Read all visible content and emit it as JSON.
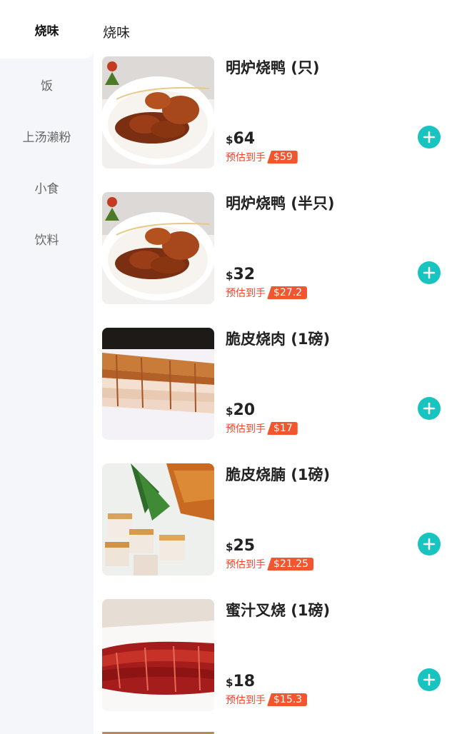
{
  "sidebar": {
    "items": [
      {
        "label": "烧味",
        "active": true
      },
      {
        "label": "饭"
      },
      {
        "label": "上汤濑粉"
      },
      {
        "label": "小食"
      },
      {
        "label": "饮料"
      }
    ]
  },
  "main": {
    "section_title": "烧味",
    "est_label": "预估到手",
    "add_icon": "plus-circle-icon",
    "accent_color": "#18c4c0",
    "badge_color": "#f2562f",
    "items": [
      {
        "name": "明炉烧鸭 (只)",
        "currency": "$",
        "price": "64",
        "est_price": "$59",
        "image": "roast-duck-image"
      },
      {
        "name": "明炉烧鸭 (半只)",
        "currency": "$",
        "price": "32",
        "est_price": "$27.2",
        "image": "roast-duck-image"
      },
      {
        "name": "脆皮烧肉 (1磅)",
        "currency": "$",
        "price": "20",
        "est_price": "$17",
        "image": "roast-pork-image"
      },
      {
        "name": "脆皮烧腩 (1磅)",
        "currency": "$",
        "price": "25",
        "est_price": "$21.25",
        "image": "roast-pork-belly-image"
      },
      {
        "name": "蜜汁叉烧 (1磅)",
        "currency": "$",
        "price": "18",
        "est_price": "$15.3",
        "image": "char-siu-image"
      }
    ]
  }
}
